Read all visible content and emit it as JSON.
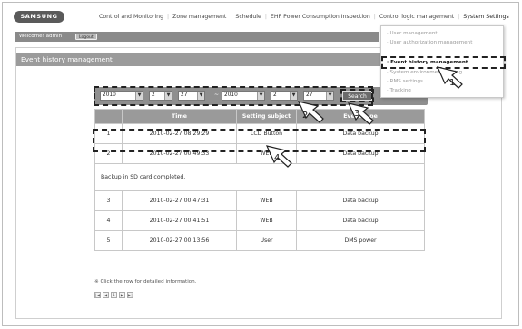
{
  "brand": {
    "logo_text": "SAMSUNG"
  },
  "topnav": {
    "items": [
      "Control and Monitoring",
      "Zone management",
      "Schedule",
      "EHP Power Consumption Inspection",
      "Control logic management",
      "System Settings"
    ]
  },
  "welcome": {
    "text": "Welcome! admin",
    "logout_label": "Logout"
  },
  "panel": {
    "title": "Event history management"
  },
  "dropdown": {
    "items": [
      "· User management",
      "· User authorization management",
      "· Event history management",
      "· System environment setting",
      "· RMS settings",
      "· Tracking"
    ]
  },
  "filter": {
    "from_year": "2010",
    "from_month": "2",
    "from_day": "27",
    "to_year": "2010",
    "to_month": "2",
    "to_day": "27",
    "tilde": "~",
    "search_label": "Search"
  },
  "table": {
    "headers": [
      "",
      "Time",
      "Setting subject",
      "Event type"
    ],
    "rows": [
      {
        "num": "1",
        "time": "2010-02-27 08:29:29",
        "subject": "LCD Button",
        "type": "Data backup"
      },
      {
        "num": "2",
        "time": "2010-02-27 00:49:33",
        "subject": "WEB",
        "type": "Data backup"
      },
      {
        "message": "Backup in SD card completed."
      },
      {
        "num": "3",
        "time": "2010-02-27 00:47:31",
        "subject": "WEB",
        "type": "Data backup"
      },
      {
        "num": "4",
        "time": "2010-02-27 00:41:51",
        "subject": "WEB",
        "type": "Data backup"
      },
      {
        "num": "5",
        "time": "2010-02-27 00:13:56",
        "subject": "User",
        "type": "DMS power"
      }
    ]
  },
  "note": "※ Click the row for detailed information.",
  "pager": [
    "first-page-icon",
    "prev-page-icon",
    "page-1",
    "next-page-icon",
    "last-page-icon"
  ],
  "pager_labels": [
    "|◀",
    "◀",
    "1",
    "▶",
    "▶|"
  ],
  "callouts": [
    "1",
    "2",
    "3",
    "4"
  ]
}
